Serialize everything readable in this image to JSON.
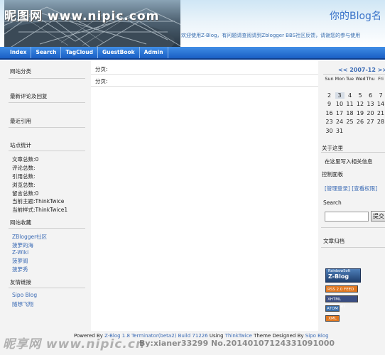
{
  "watermark": {
    "top": "昵图网 www.nipic.com",
    "bottom": "昵享网 www.nipic.cn",
    "id": "By:xianer33299 No.20140107124331091000"
  },
  "header": {
    "blog_title": "你的Blog名",
    "marquee": "欢迎使用Z-Blog，有问题请查阅请到Zblogger BBS社区反馈，请谢您的参与使用"
  },
  "nav": {
    "items": [
      "Index",
      "Search",
      "TagCloud",
      "GuestBook",
      "Admin"
    ]
  },
  "left": {
    "categories_title": "网站分类",
    "recent_comments_title": "最新评论及回复",
    "recent_trackbacks_title": "最近引用",
    "stats_title": "站点统计",
    "stats": [
      "文章总数:0",
      "评论总数:",
      "引用总数:",
      "浏览总数:",
      "留言总数:0",
      "当前主题:ThinkTwice",
      "当前样式:ThinkTwice1"
    ],
    "favorites_title": "网站收藏",
    "favorites": [
      "ZBlogger社区",
      "菠萝的海",
      "Z-Wiki",
      "菠萝阁",
      "菠萝秀"
    ],
    "links_title": "友情链接",
    "links": [
      "Sipo Blog",
      "随想飞翔"
    ]
  },
  "main": {
    "paging_label_1": "分页:",
    "paging_label_2": "分页:"
  },
  "calendar": {
    "month": "<< 2007-12 >>",
    "weekdays": [
      "Sun",
      "Mon",
      "Tue",
      "Wed",
      "Thu",
      "Fri"
    ],
    "weeks": [
      [
        "",
        "",
        "",
        "",
        "",
        ""
      ],
      [
        "2",
        "3",
        "4",
        "5",
        "6",
        "7"
      ],
      [
        "9",
        "10",
        "11",
        "12",
        "13",
        "14"
      ],
      [
        "16",
        "17",
        "18",
        "19",
        "20",
        "21"
      ],
      [
        "23",
        "24",
        "25",
        "26",
        "27",
        "28"
      ],
      [
        "30",
        "31",
        "",
        "",
        "",
        ""
      ]
    ]
  },
  "right": {
    "about_title": "关于这里",
    "about_text": "在这里写入相关信息",
    "panel_title": "控制面板",
    "panel_links": "[管理登录] [查看权限]",
    "search_title": "Search",
    "search_button": "提交",
    "archive_title": "文章归档",
    "badges": {
      "zblog_top": "RainbowSoft",
      "zblog_main": "Z-Blog",
      "rss": "RSS 2.0 FEED",
      "xhtml": "XHTML SUPPORT",
      "atom": "ATOM",
      "xml": "XML"
    }
  },
  "footer": {
    "powered_prefix": "Powered By ",
    "powered_link": "Z-Blog 1.8 Terminator(beta2) Build 71226",
    "using": " Using ",
    "theme_link": "ThinkTwice",
    "designed": " Theme Designed By ",
    "designer_link": "Sipo Blog"
  },
  "colors": {
    "nav_bg": "#1a5fc4",
    "link": "#3b6bb5",
    "title": "#3a73c9"
  }
}
